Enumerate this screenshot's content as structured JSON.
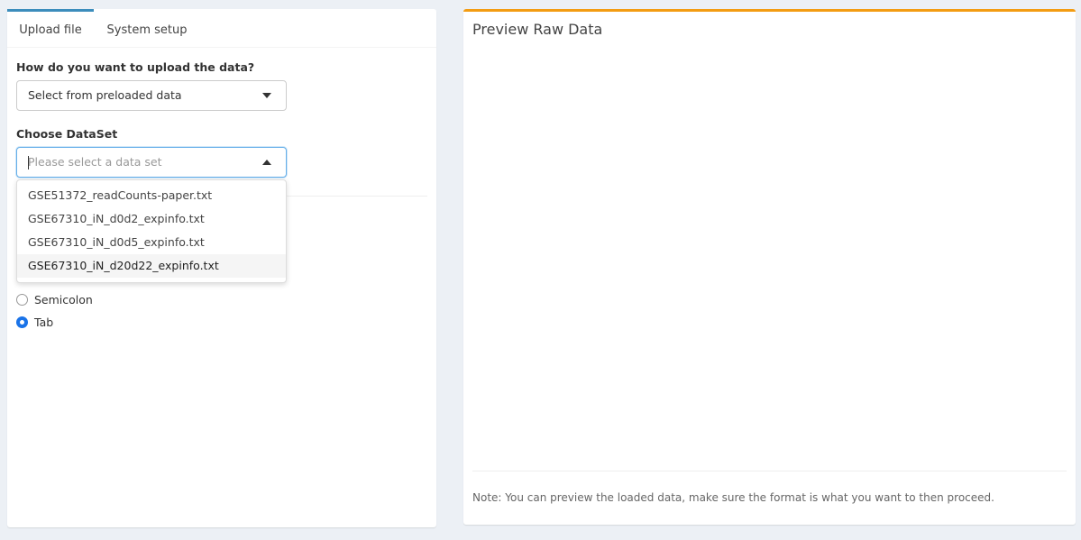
{
  "tabs": [
    {
      "label": "Upload file",
      "active": true
    },
    {
      "label": "System setup",
      "active": false
    }
  ],
  "upload_method": {
    "label": "How do you want to upload the data?",
    "value": "Select from preloaded data"
  },
  "dataset": {
    "label": "Choose DataSet",
    "placeholder": "Please select a data set",
    "options": [
      "GSE51372_readCounts-paper.txt",
      "GSE67310_iN_d0d2_expinfo.txt",
      "GSE67310_iN_d0d5_expinfo.txt",
      "GSE67310_iN_d20d22_expinfo.txt"
    ],
    "highlighted_index": 3
  },
  "separator": {
    "options": [
      {
        "label": "Semicolon",
        "checked": false
      },
      {
        "label": "Tab",
        "checked": true
      }
    ]
  },
  "preview": {
    "title": "Preview Raw Data",
    "note": "Note: You can preview the loaded data, make sure the format is what you want to then proceed."
  },
  "colors": {
    "active_tab_border": "#3c8dbc",
    "panel_accent": "#f39c12",
    "radio_checked": "#1a73e8",
    "background": "#ecf0f5"
  }
}
